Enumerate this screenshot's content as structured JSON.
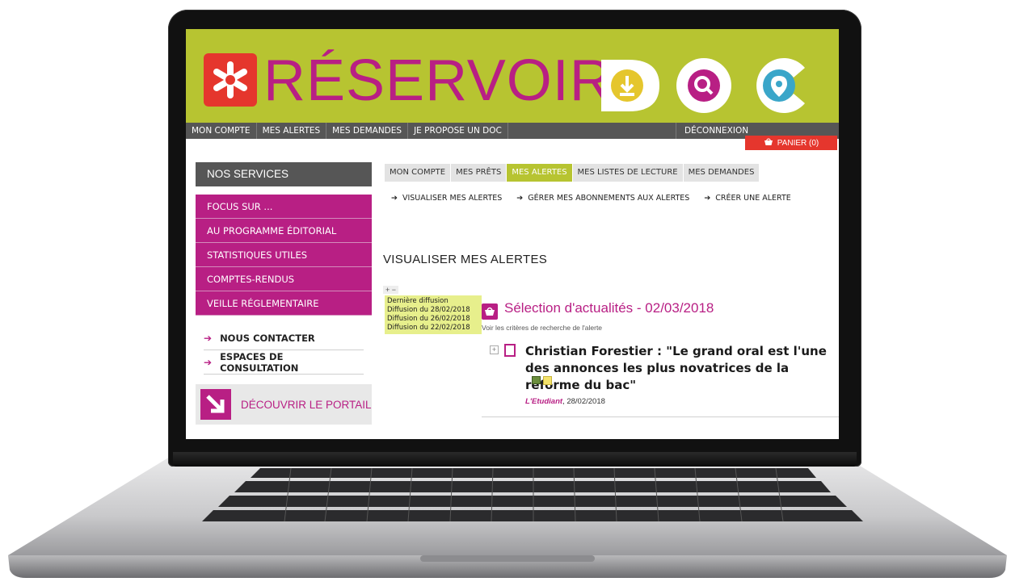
{
  "logo": {
    "title": "RÉSERVOIR",
    "doc_word": "DOC"
  },
  "topnav": {
    "items": [
      "MON COMPTE",
      "MES ALERTES",
      "MES DEMANDES",
      "JE PROPOSE UN DOC"
    ],
    "logout": "DÉCONNEXION",
    "cart": "PANIER (0)"
  },
  "sidebar": {
    "heading": "NOS SERVICES",
    "menu": [
      "FOCUS SUR ...",
      "AU PROGRAMME ÉDITORIAL",
      "STATISTIQUES UTILES",
      "COMPTES-RENDUS",
      "VEILLE RÉGLEMENTAIRE"
    ],
    "links": [
      "NOUS CONTACTER",
      "ESPACES DE CONSULTATION"
    ],
    "discover": "DÉCOUVRIR LE PORTAIL"
  },
  "tabs": [
    "MON COMPTE",
    "MES PRÊTS",
    "MES ALERTES",
    "MES LISTES DE LECTURE",
    "MES DEMANDES"
  ],
  "subnav": [
    "VISUALISER MES ALERTES",
    "GÉRER MES ABONNEMENTS AUX ALERTES",
    "CRÉER UNE ALERTE"
  ],
  "main": {
    "title": "VISUALISER MES ALERTES",
    "expand": "+ −",
    "diffusions": [
      "Dernière diffusion",
      "Diffusion du 28/02/2018",
      "Diffusion du 26/02/2018",
      "Diffusion du 22/02/2018"
    ],
    "selection_title": "Sélection d'actualités - 02/03/2018",
    "criteria": "Voir les critères de recherche de l'alerte",
    "article": {
      "title": "Christian Forestier : \"Le grand oral est l'une des annonces les plus novatrices de la réforme du bac\"",
      "source": "L'Etudiant",
      "date": ", 28/02/2018"
    }
  },
  "colors": {
    "brand_green": "#b7c431",
    "brand_magenta": "#b81f84",
    "logo_red": "#e5362d",
    "nav_gray": "#565656"
  },
  "icons": [
    "logo-asterisk-icon",
    "download-icon",
    "search-icon",
    "location-pin-icon",
    "cart-icon",
    "arrow-right-icon",
    "basket-icon",
    "document-icon"
  ]
}
